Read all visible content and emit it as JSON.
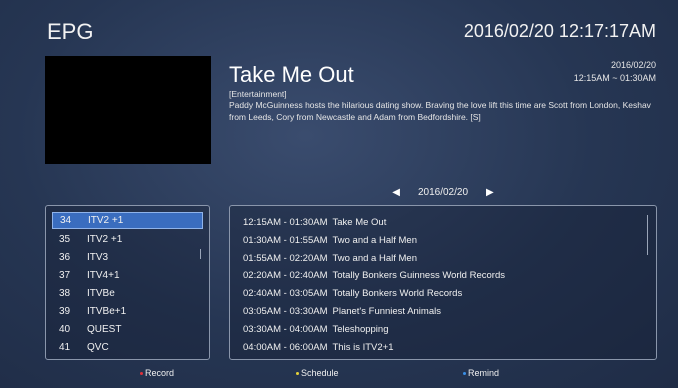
{
  "header": {
    "title": "EPG",
    "clock": "2016/02/20 12:17:17AM"
  },
  "program": {
    "title": "Take Me Out",
    "date": "2016/02/20",
    "time": "12:15AM ~ 01:30AM",
    "genre": "[Entertainment]",
    "description": "Paddy McGuinness hosts the hilarious dating show. Braving the love lift this time are Scott from London, Keshav from Leeds, Cory from Newcastle and Adam from Bedfordshire. [S]"
  },
  "date_nav": {
    "date": "2016/02/20",
    "prev_icon": "left-triangle-icon",
    "next_icon": "right-triangle-icon"
  },
  "channels": [
    {
      "num": "34",
      "name": "ITV2 +1",
      "selected": true
    },
    {
      "num": "35",
      "name": "ITV2 +1"
    },
    {
      "num": "36",
      "name": "ITV3"
    },
    {
      "num": "37",
      "name": "ITV4+1"
    },
    {
      "num": "38",
      "name": "ITVBe"
    },
    {
      "num": "39",
      "name": "ITVBe+1"
    },
    {
      "num": "40",
      "name": "QUEST"
    },
    {
      "num": "41",
      "name": "QVC"
    }
  ],
  "schedule": [
    {
      "time": "12:15AM - 01:30AM",
      "title": "Take Me Out"
    },
    {
      "time": "01:30AM - 01:55AM",
      "title": "Two and a Half Men"
    },
    {
      "time": "01:55AM - 02:20AM",
      "title": "Two and a Half Men"
    },
    {
      "time": "02:20AM - 02:40AM",
      "title": "Totally Bonkers Guinness World Records"
    },
    {
      "time": "02:40AM - 03:05AM",
      "title": "Totally Bonkers World Records"
    },
    {
      "time": "03:05AM - 03:30AM",
      "title": "Planet's Funniest Animals"
    },
    {
      "time": "03:30AM - 04:00AM",
      "title": "Teleshopping"
    },
    {
      "time": "04:00AM - 06:00AM",
      "title": "This is ITV2+1"
    }
  ],
  "legend": {
    "record": {
      "label": "Record",
      "color": "#e0303a"
    },
    "schedule": {
      "label": "Schedule",
      "color": "#e6d23a"
    },
    "remind": {
      "label": "Remind",
      "color": "#3a8fe6"
    }
  },
  "colors": {
    "background": "#2a3852",
    "selection": "#3a6dbf"
  }
}
